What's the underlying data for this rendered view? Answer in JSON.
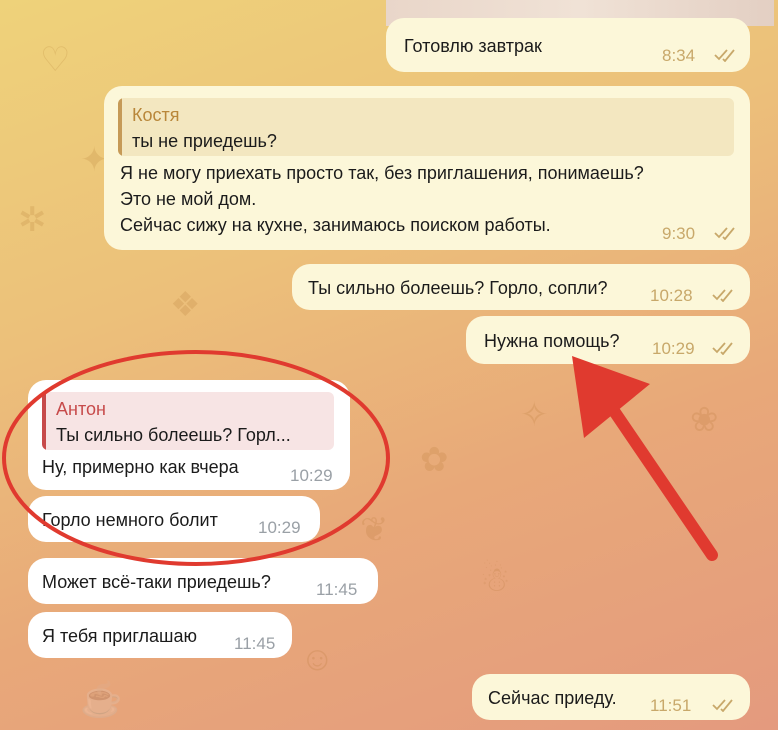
{
  "messages": [
    {
      "text": "Готовлю завтрак",
      "time": "8:34"
    },
    {
      "reply_author": "Костя",
      "reply_text": "ты не приедешь?",
      "lines": [
        "Я не могу приехать просто так, без приглашения, понимаешь?",
        "Это не мой дом.",
        "Сейчас сижу на кухне, занимаюсь поиском работы."
      ],
      "time": "9:30"
    },
    {
      "text": "Ты сильно болеешь? Горло, сопли?",
      "time": "10:28"
    },
    {
      "text": "Нужна помощь?",
      "time": "10:29"
    },
    {
      "reply_author": "Антон",
      "reply_text": "Ты сильно болеешь? Горл...",
      "text": "Ну, примерно как вчера",
      "time": "10:29"
    },
    {
      "text": "Горло немного болит",
      "time": "10:29"
    },
    {
      "text": "Может всё-таки приедешь?",
      "time": "11:45"
    },
    {
      "text": "Я тебя приглашаю",
      "time": "11:45"
    },
    {
      "text": "Сейчас приеду.",
      "time": "11:51"
    }
  ],
  "colors": {
    "outgoing_bubble": "#fcf7d9",
    "incoming_bubble": "#ffffff",
    "reply_out_accent": "#c69a57",
    "reply_in_accent": "#c74b4b",
    "annotation_red": "#e03a2f",
    "read_ticks": "#c8a86a"
  },
  "icons": [
    "double-check-icon"
  ],
  "annotations": [
    "red-ellipse-highlight",
    "red-arrow-pointer"
  ]
}
